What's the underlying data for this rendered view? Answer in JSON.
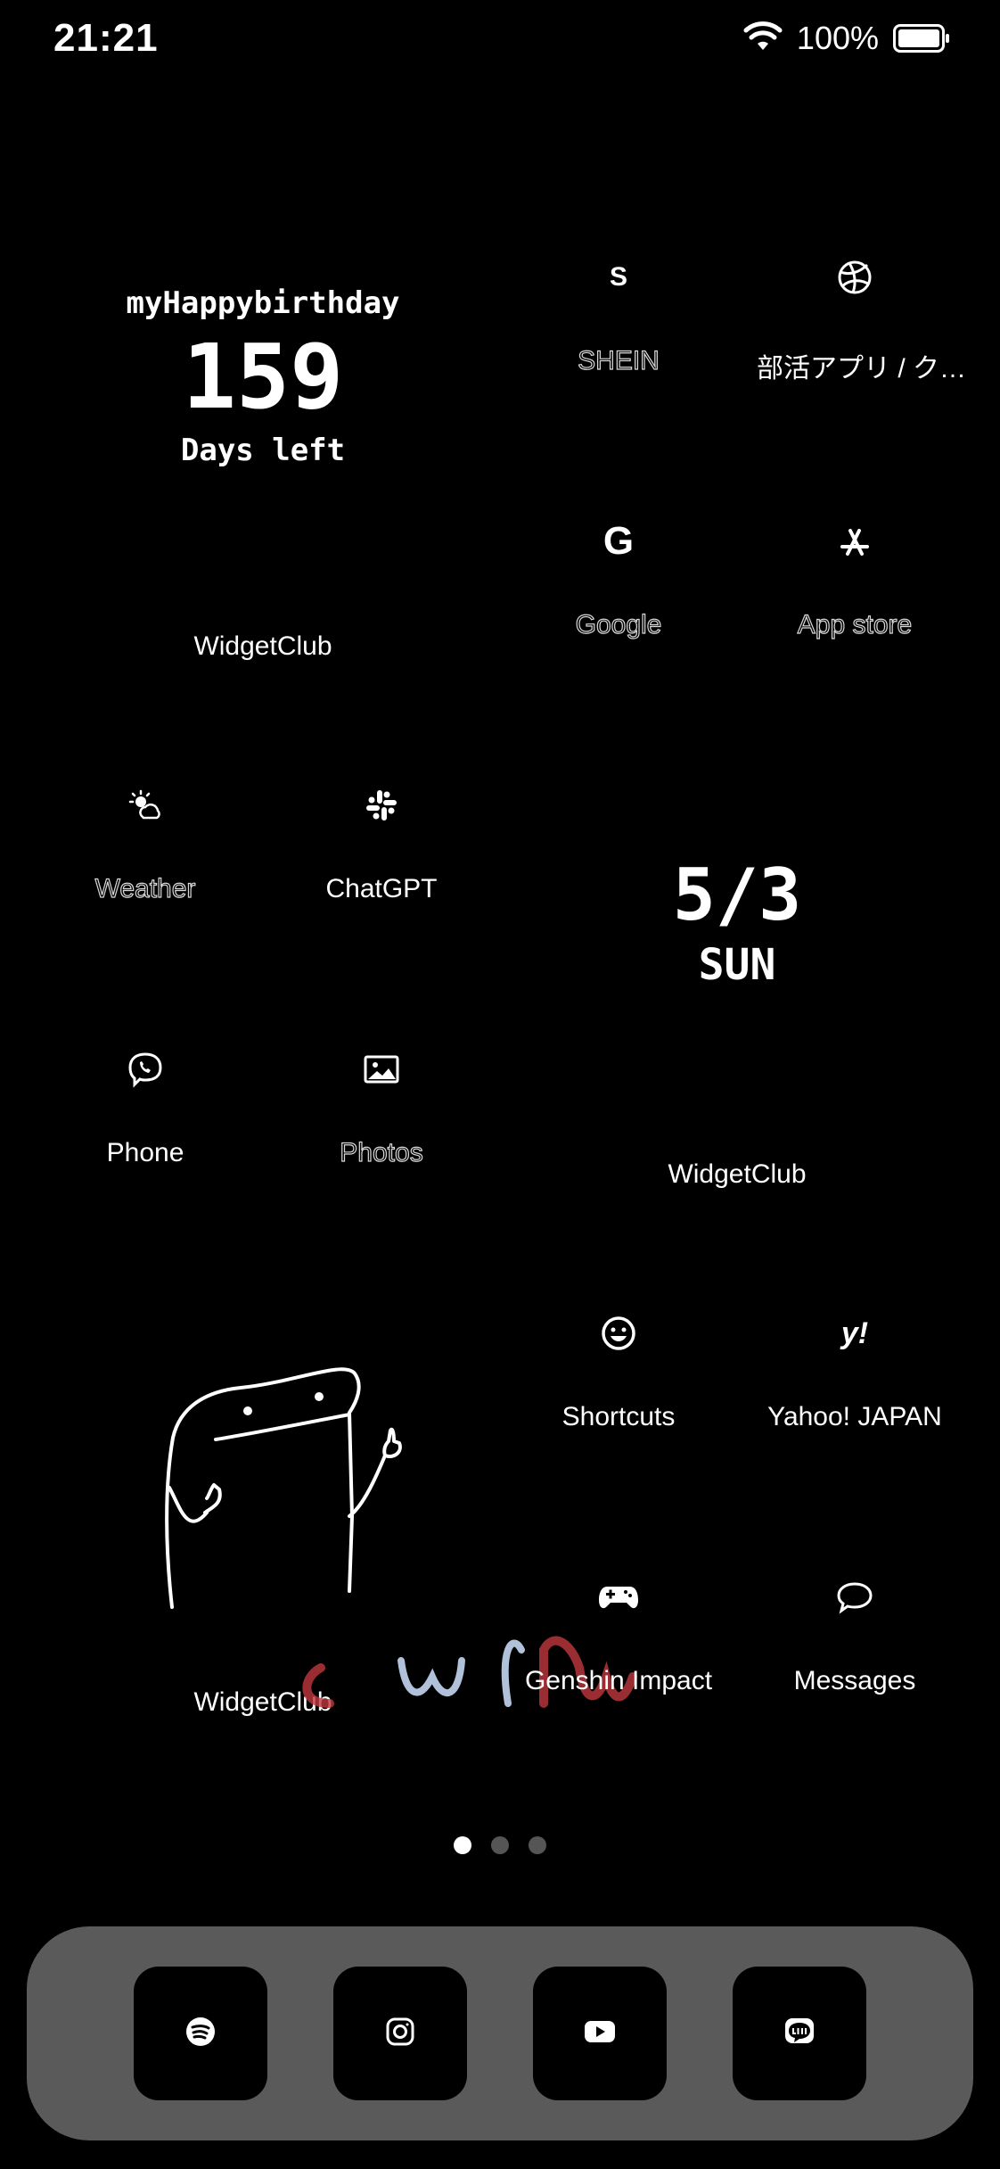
{
  "status_bar": {
    "time": "21:21",
    "battery": "100%"
  },
  "birthday_widget": {
    "title": "myHappybirthday",
    "count": "159",
    "subtitle": "Days left",
    "label": "WidgetClub"
  },
  "date_widget": {
    "date": "5/3",
    "day": "SUN",
    "label": "WidgetClub"
  },
  "drawing_widget": {
    "label": "WidgetClub"
  },
  "apps": {
    "shein": {
      "glyph": "S",
      "name": "SHEIN",
      "icon": "shein-icon"
    },
    "bukatsu": {
      "name": "部活アプリ / ク…",
      "icon": "basketball-icon"
    },
    "google": {
      "glyph": "G",
      "name": "Google",
      "icon": "google-icon"
    },
    "appstore": {
      "name": "App store",
      "icon": "app-store-icon"
    },
    "weather": {
      "name": "Weather",
      "icon": "weather-icon"
    },
    "chatgpt": {
      "name": "ChatGPT",
      "icon": "slack-icon"
    },
    "phone": {
      "name": "Phone",
      "icon": "viber-phone-icon"
    },
    "photos": {
      "name": "Photos",
      "icon": "image-icon"
    },
    "shortcuts": {
      "name": "Shortcuts",
      "icon": "smiley-icon"
    },
    "yahoo": {
      "glyph": "y!",
      "name": "Yahoo! JAPAN",
      "icon": "yahoo-icon"
    },
    "genshin": {
      "name": "Genshin Impact",
      "icon": "gamepad-icon"
    },
    "messages": {
      "name": "Messages",
      "icon": "chat-bubble-icon"
    }
  },
  "page_indicator": {
    "count": 3,
    "active": 1
  },
  "dock": [
    "spotify-icon",
    "instagram-icon",
    "youtube-icon",
    "line-icon"
  ]
}
